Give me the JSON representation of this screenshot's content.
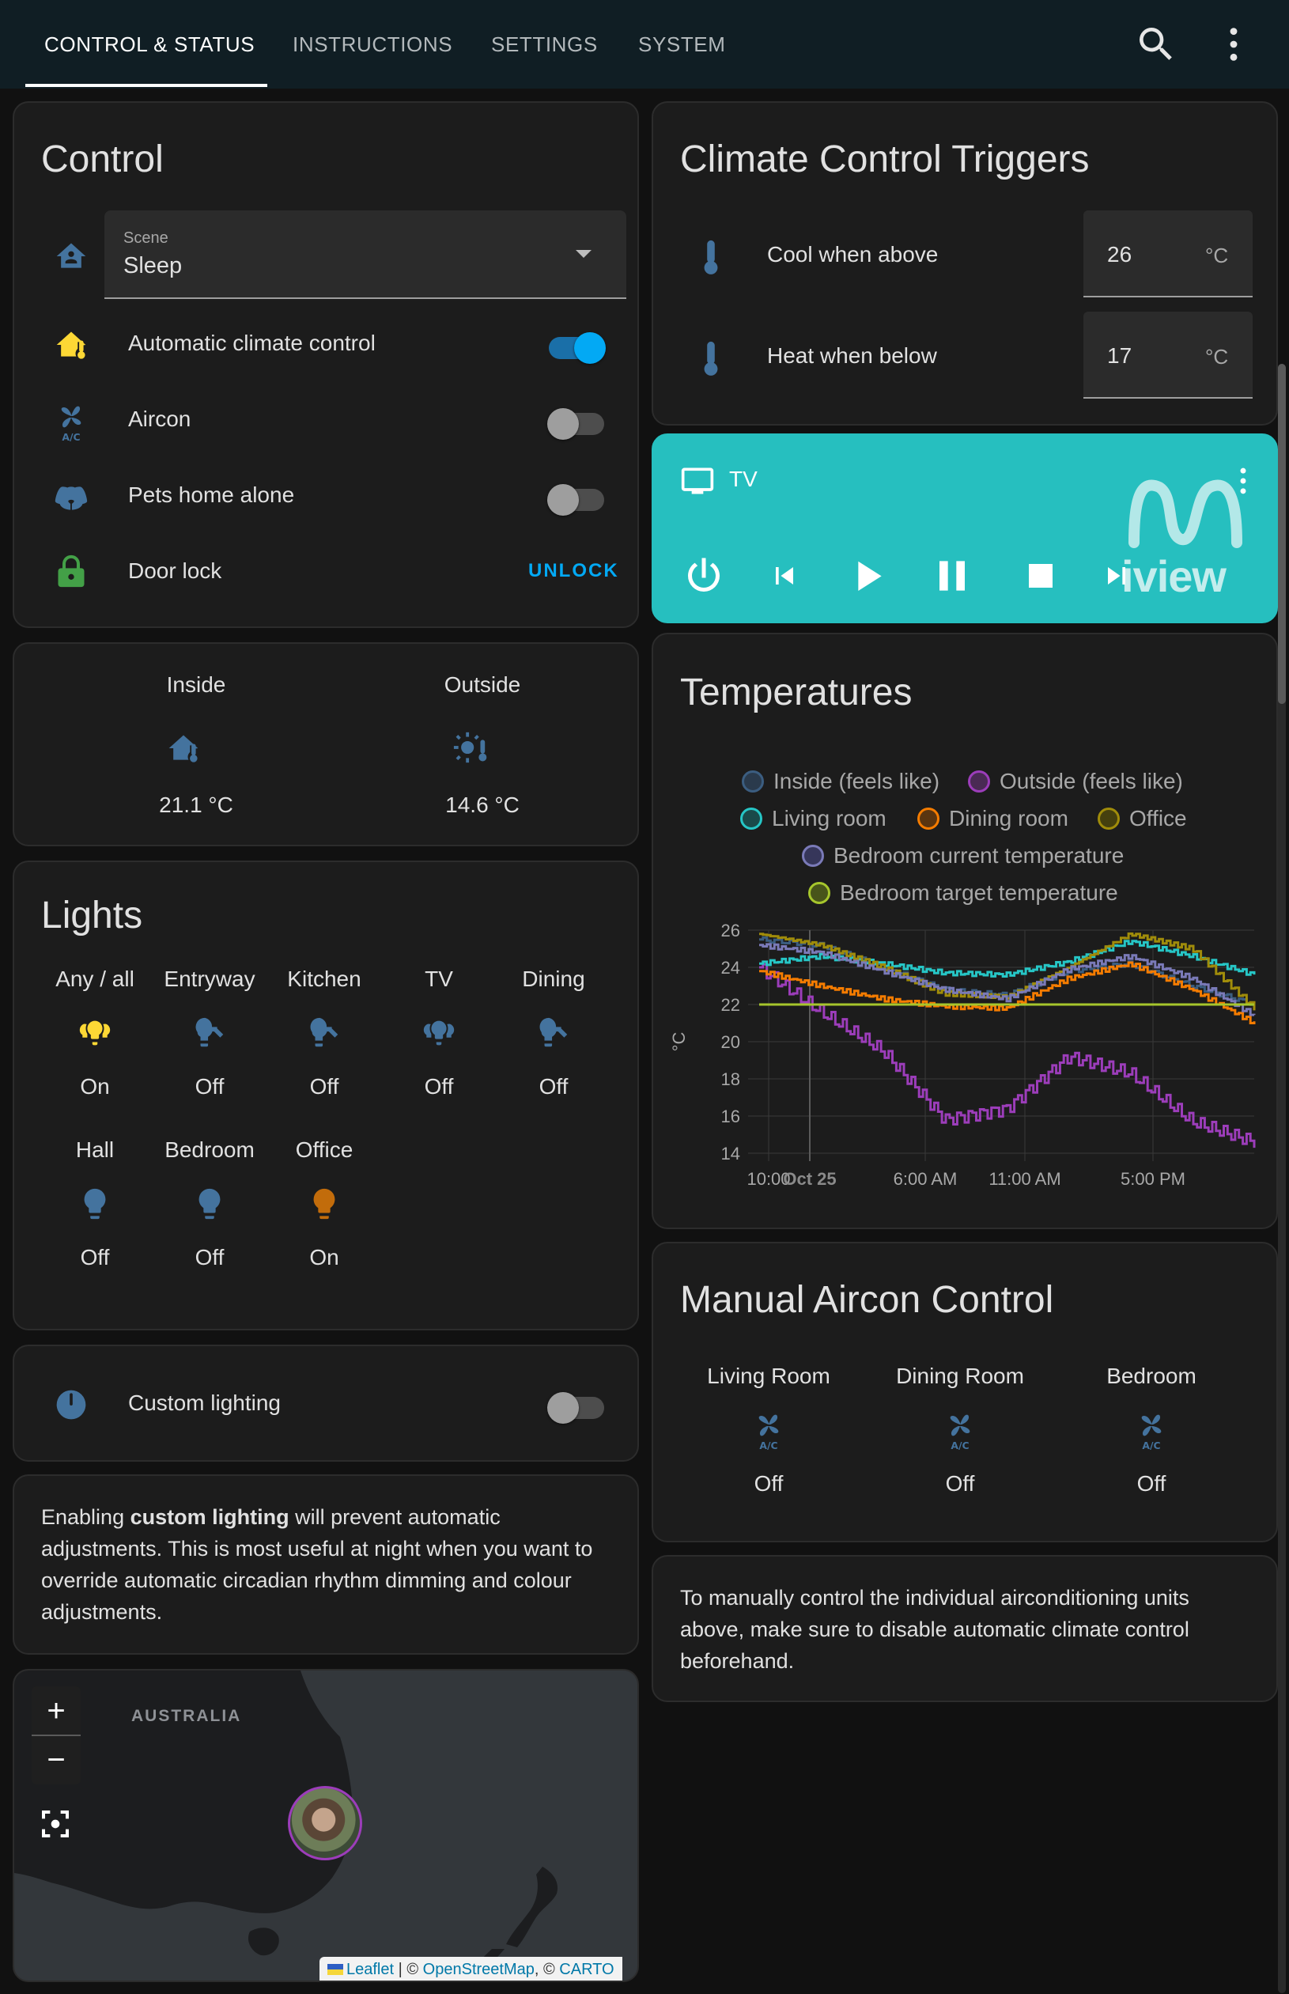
{
  "tabs": [
    "CONTROL & STATUS",
    "INSTRUCTIONS",
    "SETTINGS",
    "SYSTEM"
  ],
  "control": {
    "title": "Control",
    "scene_label": "Scene",
    "scene_value": "Sleep",
    "rows": [
      {
        "label": "Automatic climate control",
        "state": "on"
      },
      {
        "label": "Aircon",
        "state": "off"
      },
      {
        "label": "Pets home alone",
        "state": "off"
      }
    ],
    "door_lock_label": "Door lock",
    "unlock_label": "UNLOCK"
  },
  "sensors": {
    "inside_label": "Inside",
    "inside_value": "21.1 °C",
    "outside_label": "Outside",
    "outside_value": "14.6 °C"
  },
  "lights": {
    "title": "Lights",
    "items": [
      {
        "name": "Any / all",
        "state": "On",
        "icon": "lightbulb-group-icon",
        "color": "#fdd835"
      },
      {
        "name": "Entryway",
        "state": "Off",
        "icon": "lightbulb-spot-icon",
        "color": "#44739e"
      },
      {
        "name": "Kitchen",
        "state": "Off",
        "icon": "lightbulb-spot-icon",
        "color": "#44739e"
      },
      {
        "name": "TV",
        "state": "Off",
        "icon": "lightbulb-group-icon",
        "color": "#44739e"
      },
      {
        "name": "Dining",
        "state": "Off",
        "icon": "lightbulb-spot-icon",
        "color": "#44739e"
      },
      {
        "name": "Hall",
        "state": "Off",
        "icon": "lightbulb-icon",
        "color": "#44739e"
      },
      {
        "name": "Bedroom",
        "state": "Off",
        "icon": "lightbulb-icon",
        "color": "#44739e"
      },
      {
        "name": "Office",
        "state": "On",
        "icon": "lightbulb-icon",
        "color": "#c26c0b"
      }
    ]
  },
  "custom_lighting": {
    "label": "Custom lighting",
    "state": "off"
  },
  "custom_note": {
    "pre": "Enabling ",
    "bold": "custom lighting",
    "post": " will prevent automatic adjustments. This is most useful at night when you want to override automatic circadian rhythm dimming and colour adjustments."
  },
  "map": {
    "country_label": "AUSTRALIA",
    "zoom_in": "+",
    "zoom_out": "−",
    "attribution": {
      "leaflet": "Leaflet",
      "sep1": " | © ",
      "osm": "OpenStreetMap",
      "sep2": ", © ",
      "carto": "CARTO"
    }
  },
  "triggers": {
    "title": "Climate Control Triggers",
    "cool_label": "Cool when above",
    "cool_value": "26",
    "cool_unit": "°C",
    "heat_label": "Heat when below",
    "heat_value": "17",
    "heat_unit": "°C"
  },
  "media": {
    "name": "TV",
    "logo_text": "iview",
    "accent": "#26bfbf"
  },
  "temperatures": {
    "title": "Temperatures"
  },
  "chart_data": {
    "type": "line",
    "ylabel": "°C",
    "ylim": [
      14,
      26
    ],
    "yticks": [
      14,
      16,
      18,
      20,
      22,
      24,
      26
    ],
    "x": [
      "10:00 PM",
      "Oct 25",
      "6:00 AM",
      "11:00 AM",
      "5:00 PM"
    ],
    "x_tick_labels": [
      "10:00 PM",
      "Oct 25",
      "6:00 AM",
      "11:00 AM",
      "5:00 PM"
    ],
    "x_tick_labels_as_drawn": [
      "10:00 ",
      "Oct 25",
      "6:00 AM",
      "11:00 AM",
      "5:00 PM"
    ],
    "grid": true,
    "legend_placement": "top",
    "series": [
      {
        "name": "Inside (feels like)",
        "color": "#3b5d80",
        "values": [
          25.5,
          25.2,
          24.0,
          22.8,
          22.5,
          23.8,
          24.2,
          23.0,
          22.0
        ]
      },
      {
        "name": "Outside (feels like)",
        "color": "#9c3dba",
        "values": [
          24.0,
          21.6,
          19.5,
          15.8,
          16.4,
          19.2,
          18.3,
          15.7,
          14.6
        ]
      },
      {
        "name": "Living room",
        "color": "#26c6c6",
        "values": [
          24.2,
          24.6,
          24.2,
          23.7,
          23.6,
          24.3,
          25.4,
          24.6,
          23.6
        ]
      },
      {
        "name": "Dining room",
        "color": "#f57c00",
        "values": [
          23.8,
          23.0,
          22.3,
          21.9,
          21.8,
          23.4,
          24.2,
          22.8,
          21.0
        ]
      },
      {
        "name": "Office",
        "color": "#a08c0a",
        "values": [
          25.8,
          25.2,
          24.0,
          22.6,
          22.4,
          24.0,
          25.8,
          25.0,
          21.8
        ]
      },
      {
        "name": "Bedroom current temperature",
        "color": "#7a7ab8",
        "values": [
          25.2,
          24.8,
          23.8,
          22.8,
          22.3,
          23.9,
          24.6,
          23.4,
          21.4
        ]
      },
      {
        "name": "Bedroom target temperature",
        "color": "#a6c62c",
        "values": [
          22,
          22,
          22,
          22,
          22,
          22,
          22,
          22,
          22
        ]
      }
    ]
  },
  "aircon": {
    "title": "Manual Aircon Control",
    "rooms": [
      {
        "name": "Living Room",
        "state": "Off"
      },
      {
        "name": "Dining Room",
        "state": "Off"
      },
      {
        "name": "Bedroom",
        "state": "Off"
      }
    ]
  },
  "aircon_note": "To manually control the individual airconditioning units above, make sure to disable automatic climate control beforehand.",
  "colors": {
    "accent": "#03a9f4",
    "icon": "#44739e",
    "warning": "#fdd835",
    "lock": "#43a047"
  }
}
